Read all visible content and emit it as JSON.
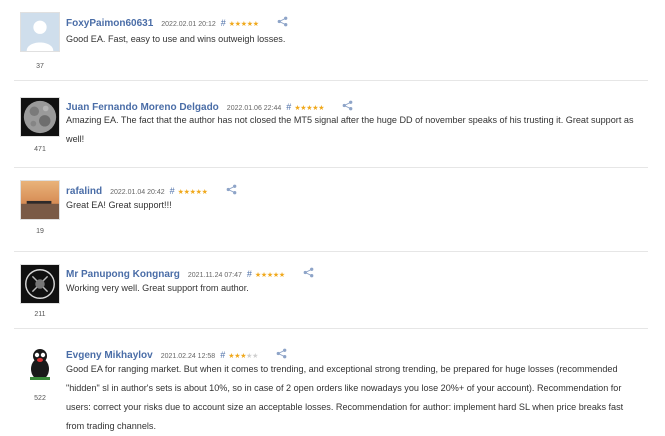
{
  "reviews": [
    {
      "author": "FoxyPaimon60631",
      "date": "2022.02.01 20:12",
      "rating": 5,
      "rating_count": "37",
      "text": "Good EA. Fast, easy to use and wins outweigh losses.",
      "avatar_icon": "default-user-avatar"
    },
    {
      "author": "Juan Fernando Moreno Delgado",
      "date": "2022.01.06 22:44",
      "rating": 5,
      "rating_count": "471",
      "text": "Amazing EA. The fact that the author has not closed the MT5 signal after the huge DD of november speaks of his trusting it. Great support as well!",
      "avatar_icon": "moon-photo-avatar"
    },
    {
      "author": "rafalind",
      "date": "2022.01.04 20:42",
      "rating": 5,
      "rating_count": "19",
      "text": "Great EA! Great support!!!",
      "avatar_icon": "sunset-boat-avatar"
    },
    {
      "author": "Mr Panupong Kongnarg",
      "date": "2021.11.24 07:47",
      "rating": 5,
      "rating_count": "211",
      "text": "Working very well. Great support from author.",
      "avatar_icon": "dark-emblem-avatar"
    },
    {
      "author": "Evgeny Mikhaylov",
      "date": "2021.02.24 12:58",
      "rating": 3,
      "rating_count": "522",
      "text": "Good EA for ranging market. But when it comes to trending, and exceptional strong trending, be prepared for huge losses (recommended \"hidden\" sl in author's sets is about 10%, so in case of 2 open orders like nowadays you lose 20%+ of your account). Recommendation for users: correct your risks due to account size an acceptable losses. Recommendation for author: implement hard SL when price breaks fast from trading channels.",
      "avatar_icon": "cartoon-mole-avatar"
    }
  ],
  "colors": {
    "author": "#4a6da7",
    "star_on": "#f0a91d",
    "star_off": "#cfcfcf",
    "divider": "#e6e6e6"
  },
  "hash_symbol": "#",
  "icons": {
    "share": "share-icon",
    "star": "star-icon"
  }
}
